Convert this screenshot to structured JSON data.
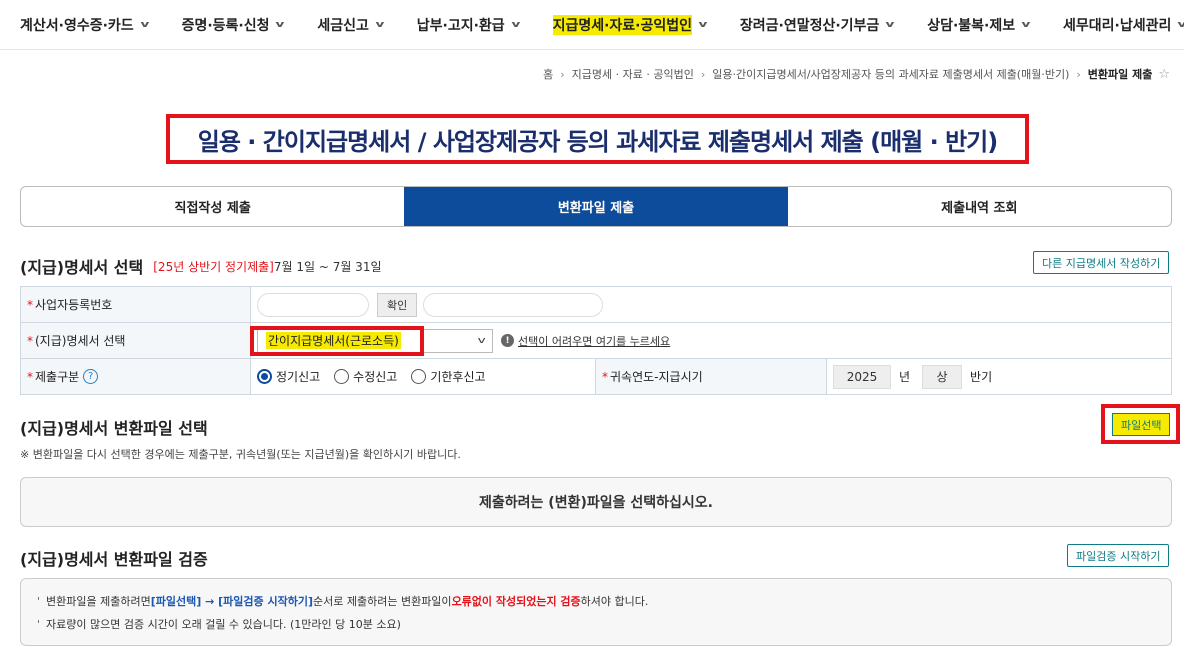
{
  "nav": {
    "items": [
      {
        "label": "계산서·영수증·카드"
      },
      {
        "label": "증명·등록·신청"
      },
      {
        "label": "세금신고"
      },
      {
        "label": "납부·고지·환급"
      },
      {
        "label": "지급명세·자료·공익법인"
      },
      {
        "label": "장려금·연말정산·기부금"
      },
      {
        "label": "상담·불복·제보"
      },
      {
        "label": "세무대리·납세관리"
      }
    ],
    "active_index": 4,
    "highlight_color": "#f5ea00"
  },
  "breadcrumb": {
    "home": "홈",
    "level1": "지급명세 · 자료 · 공익법인",
    "level2": "일용·간이지급명세서/사업장제공자 등의 과세자료 제출명세서 제출(매월·반기)",
    "current": "변환파일 제출"
  },
  "page_title": "일용 · 간이지급명세서 / 사업장제공자 등의 과세자료 제출명세서 제출 (매월 · 반기)",
  "tabs": [
    {
      "label": "직접작성 제출"
    },
    {
      "label": "변환파일 제출"
    },
    {
      "label": "제출내역 조회"
    }
  ],
  "active_tab": 1,
  "section_select": {
    "title": "(지급)명세서 선택",
    "period_note": "[25년 상반기 정기제출]",
    "period": "7월 1일 ~ 7월 31일",
    "other_button": "다른 지급명세서 작성하기"
  },
  "form": {
    "biz_no_label": "사업자등록번호",
    "biz_no_value": "",
    "confirm_button": "확인",
    "statement_label": "(지급)명세서 선택",
    "statement_value": "간이지급명세서(근로소득)",
    "help_link": "선택이 어려우면 여기를 누르세요",
    "submit_type_label": "제출구분",
    "submit_types": [
      "정기신고",
      "수정신고",
      "기한후신고"
    ],
    "submit_type_selected": 0,
    "year_label": "귀속연도-지급시기",
    "year_value": "2025",
    "year_unit": "년",
    "half_value": "상",
    "half_unit": "반기"
  },
  "section_file": {
    "title": "(지급)명세서 변환파일 선택",
    "file_button": "파일선택",
    "note": "※ 변환파일을 다시 선택한 경우에는 제출구분, 귀속년월(또는 지급년월)을 확인하시기 바랍니다.",
    "drop_text": "제출하려는 (변환)파일을 선택하십시오."
  },
  "section_verify": {
    "title": "(지급)명세서 변환파일 검증",
    "verify_button": "파일검증 시작하기",
    "line1_a": "변환파일을 제출하려면 ",
    "line1_b": "[파일선택] → [파일검증 시작하기]",
    "line1_c": " 순서로 제출하려는 변환파일이 ",
    "line1_d": "오류없이 작성되었는지 검증",
    "line1_e": "하셔야 합니다.",
    "line2": "자료량이 많으면 검증 시간이 오래 걸릴 수 있습니다. (1만라인 당 10분 소요)"
  },
  "colors": {
    "primary": "#0d4b9b",
    "highlight": "#f5ea00",
    "alert": "#e4131b",
    "teal": "#0e7c86"
  }
}
